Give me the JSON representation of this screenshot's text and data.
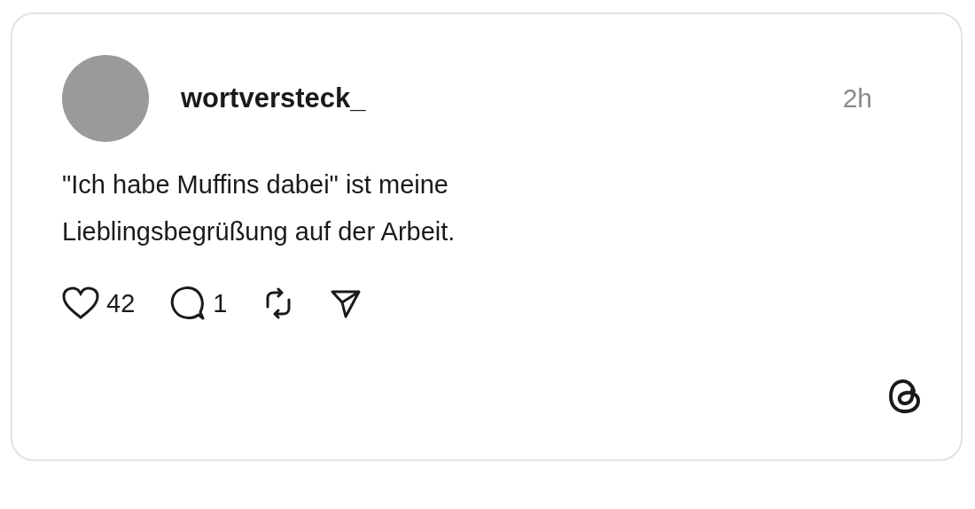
{
  "post": {
    "username": "wortversteck_",
    "time": "2h",
    "text": "\"Ich habe Muffins dabei\" ist meine Lieblingsbegrüßung auf der Arbeit.",
    "likes": "42",
    "replies": "1"
  }
}
